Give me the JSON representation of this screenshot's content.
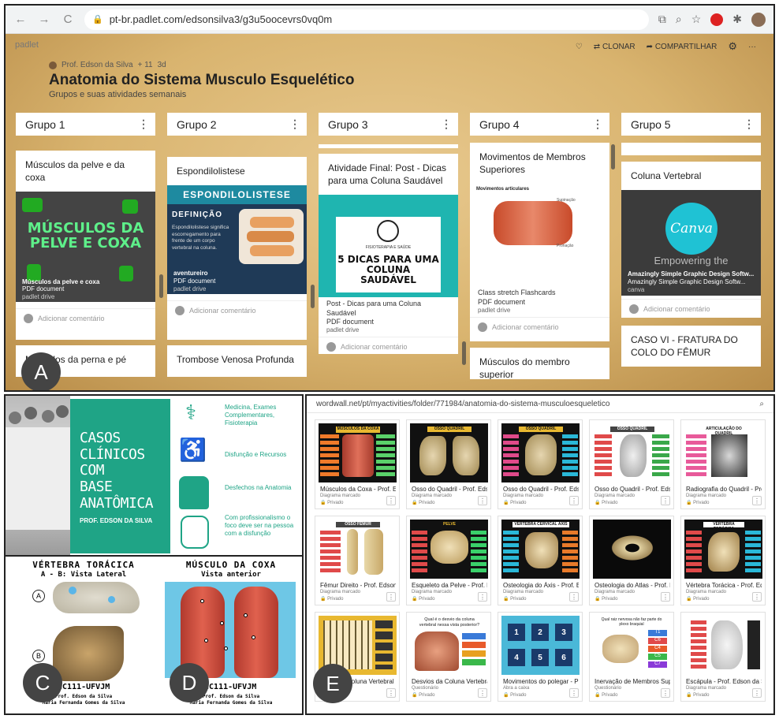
{
  "badges": {
    "a": "A",
    "c": "C",
    "d": "D",
    "e": "E"
  },
  "browser": {
    "url": "pt-br.padlet.com/edsonsilva3/g3u5oocevrs0vq0m",
    "nav_back": "←",
    "nav_forward": "→",
    "nav_reload": "C"
  },
  "padlet": {
    "logo": "padlet",
    "author": "Prof. Edson da Silva",
    "likes": "+ 11",
    "age": "3d",
    "title": "Anatomia do Sistema Musculo Esquelético",
    "subtitle": "Grupos e suas atividades semanais",
    "action_clone": "CLONAR",
    "action_share": "COMPARTILHAR",
    "add_comment": "Adicionar comentário",
    "plus": "+",
    "columns": [
      {
        "header": "Grupo 1",
        "card1": "Músculos da pelve e da coxa",
        "img_text": "MÚSCULOS DA PELVE E COXA",
        "meta_title": "Músculos da pelve e coxa",
        "meta_type": "PDF document",
        "meta_src": "padlet drive",
        "card2": "Músculos da perna e pé"
      },
      {
        "header": "Grupo 2",
        "card1": "Espondilolistese",
        "img_banner": "ESPONDILOLISTESE",
        "img_def": "DEFINIÇÃO",
        "img_body": "Espondilolistese significa escorregamento para frente de um corpo vertebral na coluna.",
        "meta_title": "aventureiro",
        "meta_type": "PDF document",
        "meta_src": "padlet drive",
        "card2": "Trombose Venosa Profunda"
      },
      {
        "header": "Grupo 3",
        "card1": "Atividade Final: Post - Dicas para uma Coluna Saudável",
        "img_small": "FISIOTERAPIA E SAÚDE",
        "img_text": "5 DICAS PARA UMA COLUNA SAUDÁVEL",
        "meta_title": "Post - Dicas para uma Coluna Saudável",
        "meta_type": "PDF document",
        "meta_src": "padlet drive"
      },
      {
        "header": "Grupo 4",
        "card1": "Movimentos de Membros Superiores",
        "img_text": "Movimentos articulares",
        "img_small": "Supinação",
        "img_small2": "Pronação",
        "meta_title": "Class stretch Flashcards",
        "meta_type": "PDF document",
        "meta_src": "padlet drive",
        "card2": "Músculos do membro superior"
      },
      {
        "header": "Grupo 5",
        "card1": "Coluna Vertebral",
        "img_logo": "Canva",
        "img_text": "Empowering the",
        "meta_title": "Amazingly Simple Graphic Design Softw...",
        "meta_sub": "Amazingly Simple Graphic Design Softw...",
        "meta_src": "canva",
        "card2": "CASO VI - FRATURA DO COLO DO FÊMUR"
      }
    ]
  },
  "panel_b": {
    "title_lines": [
      "CASOS",
      "CLÍNICOS COM",
      "BASE",
      "ANATÔMICA"
    ],
    "author": "PROF. EDSON DA SILVA",
    "items": [
      "Medicina, Exames Complementares, Fisioterapia",
      "Disfunção e Recursos",
      "Desfechos na Anatomia",
      "Com profissionalismo o foco deve ser na pessoa com a disfunção"
    ]
  },
  "panel_c": {
    "title": "VÉRTEBRA TORÁCICA",
    "subtitle": "A - B: Vista Lateral",
    "label_a": "A",
    "label_b": "B",
    "code": "DCC111-UFVJM",
    "credits1": "Prof. Edson da Silva",
    "credits2": "Maria Fernanda Gomes da Silva"
  },
  "panel_d": {
    "title": "MÚSCULO DA COXA",
    "subtitle": "Vista anterior",
    "code": "DCC111-UFVJM",
    "credits1": "Prof. Edson da Silva",
    "credits2": "Maria Fernanda Gomes da Silva"
  },
  "wordwall": {
    "url": "wordwall.net/pt/myactivities/folder/771984/anatomia-do-sistema-musculoesqueletico",
    "more": "⋮",
    "private": "Privado",
    "tiles": [
      {
        "title": "Músculos da Coxa - Prof. Ed...",
        "type": "Diagrama marcado",
        "thumb": "MÚSCULOS DA COXA"
      },
      {
        "title": "Osso do Quadril - Prof. Edso...",
        "type": "Diagrama marcado",
        "thumb": "OSSO QUADRIL"
      },
      {
        "title": "Osso do Quadril - Prof. Edso...",
        "type": "Diagrama marcado",
        "thumb": "OSSO QUADRIL"
      },
      {
        "title": "Osso do Quadril - Prof. Edso...",
        "type": "Diagrama marcado",
        "thumb": "OSSO QUADRIL"
      },
      {
        "title": "Radiografia do Quadril - Pro...",
        "type": "Diagrama marcado",
        "thumb": "ARTICULAÇÃO DO QUADRIL"
      },
      {
        "title": "Fêmur Direito - Prof. Edson ...",
        "type": "Diagrama marcado",
        "thumb": "OSSO FÊMUR"
      },
      {
        "title": "Esqueleto da Pelve - Prof. Ed...",
        "type": "Diagrama marcado",
        "thumb": "PELVE"
      },
      {
        "title": "Osteologia do Áxis - Prof. Ed...",
        "type": "Diagrama marcado",
        "thumb": "VÉRTEBRA CERVICAL ÁXIS"
      },
      {
        "title": "Osteologia do Atlas - Prof. E...",
        "type": "Diagrama marcado",
        "thumb": ""
      },
      {
        "title": "Vértebra Torácica - Prof. Eds...",
        "type": "Diagrama marcado",
        "thumb": "VÉRTEBRA TORÁCICA"
      },
      {
        "title": "Coluna Vertebral ...",
        "type": "",
        "thumb": ""
      },
      {
        "title": "Desvios da Coluna Vertebral...",
        "type": "Questionário",
        "thumb": "Qual é o desvio da coluna vertebral nessa vista posterior?"
      },
      {
        "title": "Movimentos do polegar - Pr...",
        "type": "Abra a caixa",
        "thumb": "",
        "boxes": [
          "1",
          "2",
          "3",
          "4",
          "5",
          "6"
        ]
      },
      {
        "title": "Inervação de Membros Sup...",
        "type": "Questionário",
        "thumb": "Qual raiz nervosa não faz parte do plexo braquial",
        "roots": [
          "T1",
          "C6",
          "C4",
          "C5",
          "C7"
        ]
      },
      {
        "title": "Escápula - Prof. Edson da Sil...",
        "type": "Diagrama marcado",
        "thumb": ""
      }
    ]
  },
  "colors": {
    "teal": "#1fa486",
    "padlet_bg": "#d9b46f",
    "badge": "#444444"
  }
}
